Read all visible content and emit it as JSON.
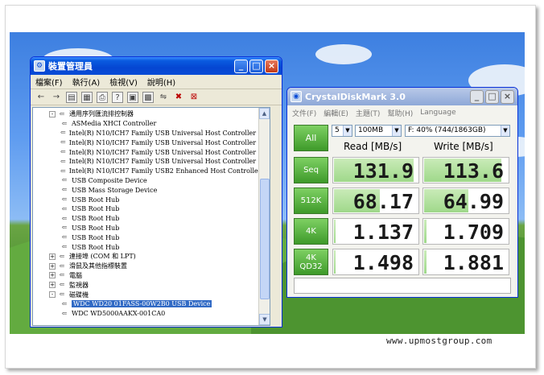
{
  "device_manager": {
    "title": "裝置管理員",
    "menu": [
      "檔案(F)",
      "執行(A)",
      "檢視(V)",
      "說明(H)"
    ],
    "tree": [
      {
        "indent": 1,
        "exp": "-",
        "icon": "usb-controller-icon",
        "label": "通用序列匯流排控制器"
      },
      {
        "indent": 2,
        "icon": "usb-icon",
        "label": "ASMedia XHCI Controller"
      },
      {
        "indent": 2,
        "icon": "usb-icon",
        "label": "Intel(R) N10/ICH7 Family USB Universal Host Controller - 27C8"
      },
      {
        "indent": 2,
        "icon": "usb-icon",
        "label": "Intel(R) N10/ICH7 Family USB Universal Host Controller - 27C9"
      },
      {
        "indent": 2,
        "icon": "usb-icon",
        "label": "Intel(R) N10/ICH7 Family USB Universal Host Controller - 27CA"
      },
      {
        "indent": 2,
        "icon": "usb-icon",
        "label": "Intel(R) N10/ICH7 Family USB Universal Host Controller - 27CB"
      },
      {
        "indent": 2,
        "icon": "usb-icon",
        "label": "Intel(R) N10/ICH7 Family USB2 Enhanced Host Controller - 27CC"
      },
      {
        "indent": 2,
        "icon": "usb-icon",
        "label": "USB Composite Device"
      },
      {
        "indent": 2,
        "icon": "usb-icon",
        "label": "USB Mass Storage Device"
      },
      {
        "indent": 2,
        "icon": "usb-icon",
        "label": "USB Root Hub"
      },
      {
        "indent": 2,
        "icon": "usb-icon",
        "label": "USB Root Hub"
      },
      {
        "indent": 2,
        "icon": "usb-icon",
        "label": "USB Root Hub"
      },
      {
        "indent": 2,
        "icon": "usb-icon",
        "label": "USB Root Hub"
      },
      {
        "indent": 2,
        "icon": "usb-icon",
        "label": "USB Root Hub"
      },
      {
        "indent": 2,
        "icon": "usb-icon",
        "label": "USB Root Hub"
      },
      {
        "indent": 1,
        "exp": "+",
        "icon": "port-icon",
        "label": "連接埠 (COM 和 LPT)"
      },
      {
        "indent": 1,
        "exp": "+",
        "icon": "mouse-icon",
        "label": "滑鼠及其他指標裝置"
      },
      {
        "indent": 1,
        "exp": "+",
        "icon": "computer-icon",
        "label": "電腦"
      },
      {
        "indent": 1,
        "exp": "+",
        "icon": "monitor-icon",
        "label": "監視器"
      },
      {
        "indent": 1,
        "exp": "-",
        "icon": "disk-drive-icon",
        "label": "磁碟機"
      },
      {
        "indent": 2,
        "icon": "disk-icon",
        "label": "WDC WD20 01FASS-00W2B0 USB Device",
        "selected": true
      },
      {
        "indent": 2,
        "icon": "disk-icon",
        "label": "WDC WD5000AAKX-001CA0"
      }
    ]
  },
  "crystal_disk_mark": {
    "title": "CrystalDiskMark 3.0",
    "menu": [
      "文件(F)",
      "編輯(E)",
      "主題(T)",
      "幫助(H)",
      "Language"
    ],
    "all_label": "All",
    "count": "5",
    "size": "100MB",
    "drive": "F: 40% (744/1863GB)",
    "read_header": "Read [MB/s]",
    "write_header": "Write [MB/s]",
    "rows": [
      {
        "label": "Seq",
        "read": "131.9",
        "write": "113.6",
        "read_frac": 0.95,
        "write_frac": 0.92
      },
      {
        "label": "512K",
        "read": "68.17",
        "write": "64.99",
        "read_frac": 0.55,
        "write_frac": 0.53
      },
      {
        "label": "4K",
        "read": "1.137",
        "write": "1.709",
        "read_frac": 0.02,
        "write_frac": 0.03
      },
      {
        "label": "4K\nQD32",
        "read": "1.498",
        "write": "1.881",
        "read_frac": 0.02,
        "write_frac": 0.03
      }
    ]
  },
  "watermark": "www.upmostgroup.com"
}
